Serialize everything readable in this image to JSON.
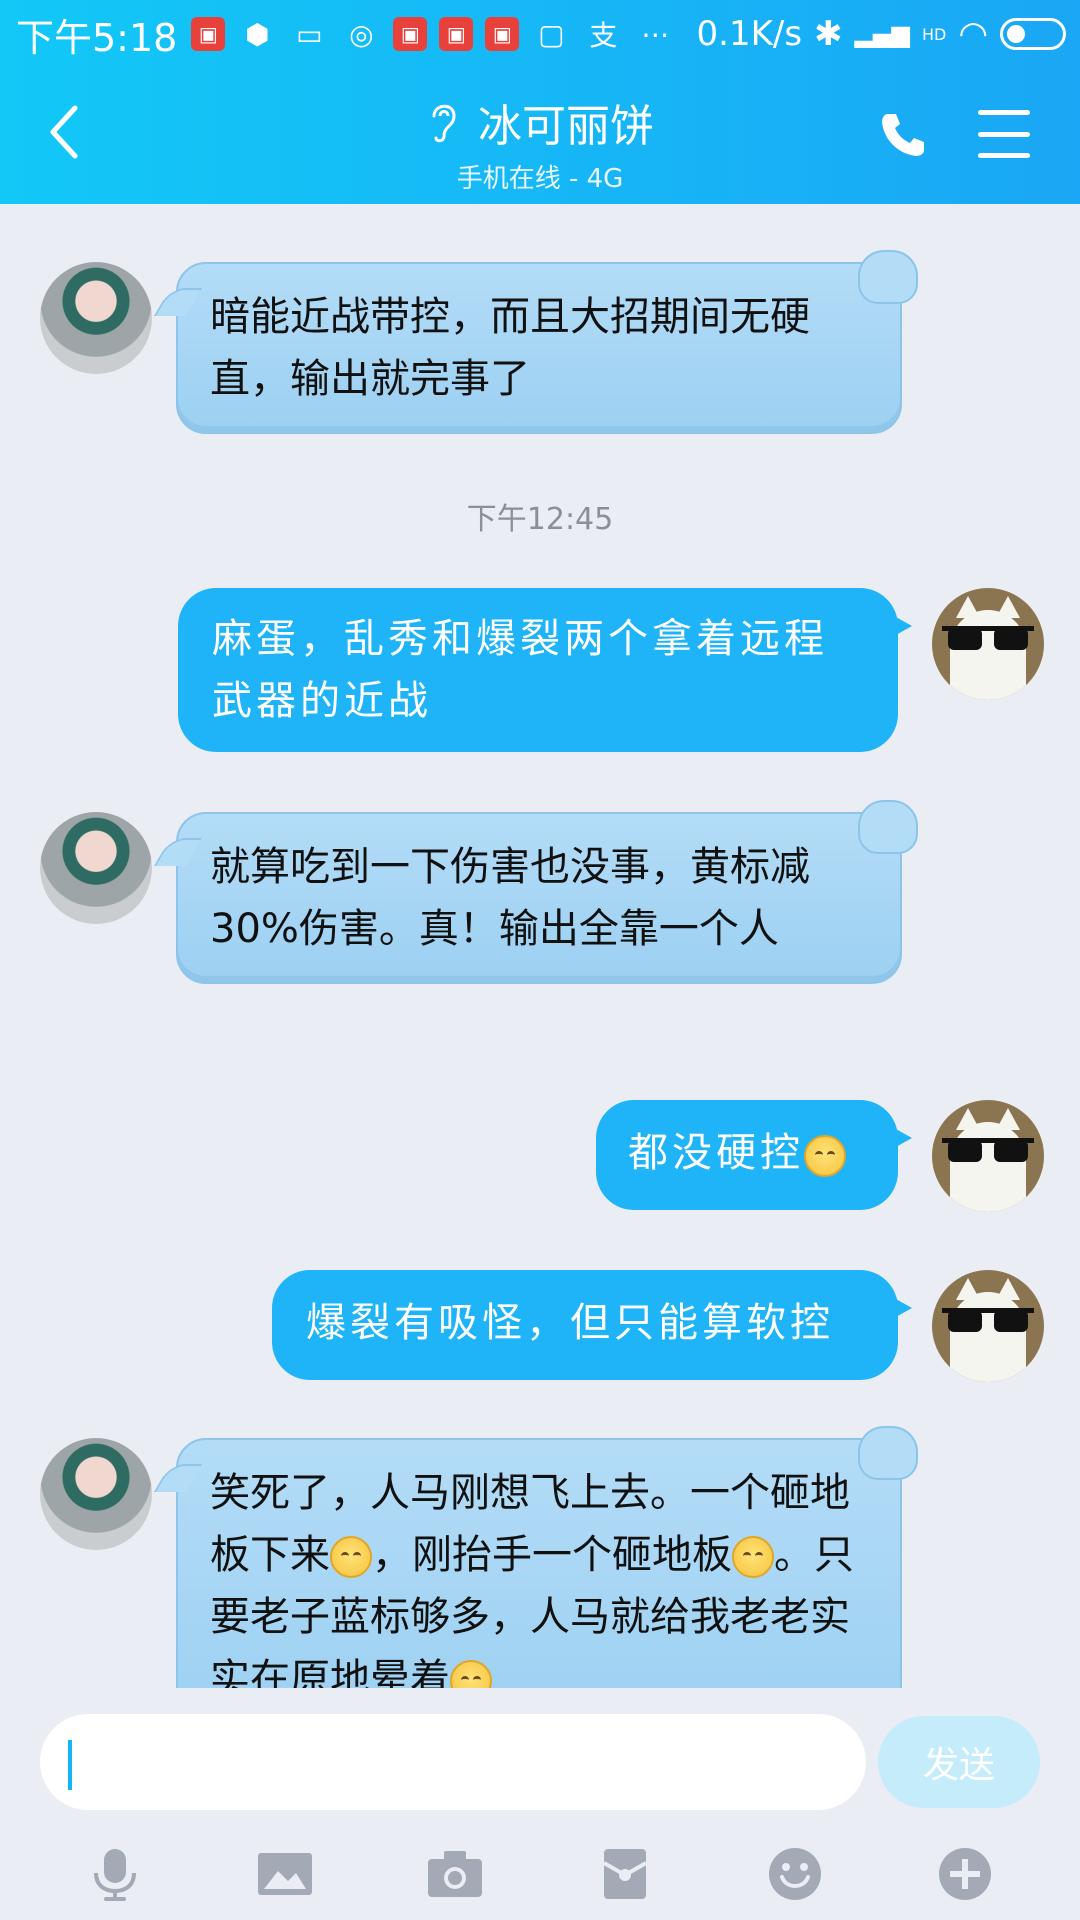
{
  "status_bar": {
    "time": "下午5:18",
    "network_speed": "0.1K/s",
    "signal_label": "HD"
  },
  "header": {
    "contact_name": "冰可丽饼",
    "status": "手机在线 - 4G"
  },
  "messages": [
    {
      "side": "in",
      "text": "暗能近战带控，而且大招期间无硬直，输出就完事了"
    },
    {
      "timestamp": "下午12:45"
    },
    {
      "side": "out",
      "text": "麻蛋，乱秀和爆裂两个拿着远程武器的近战"
    },
    {
      "side": "in",
      "text": "就算吃到一下伤害也没事，黄标减30%伤害。真！输出全靠一个人"
    },
    {
      "side": "out",
      "text": "都没硬控"
    },
    {
      "side": "out",
      "text": "爆裂有吸怪，但只能算软控"
    },
    {
      "side": "in",
      "parts": [
        "笑死了，人马刚想飞上去。一个砸地板下来",
        "，刚抬手一个砸地板",
        "。只要老子蓝标够多，人马就给我老老实实在原地晕着"
      ]
    }
  ],
  "input": {
    "value": "",
    "send_label": "发送"
  },
  "toolbar": [
    "microphone-icon",
    "image-icon",
    "camera-icon",
    "red-packet-icon",
    "emoji-icon",
    "plus-icon"
  ]
}
